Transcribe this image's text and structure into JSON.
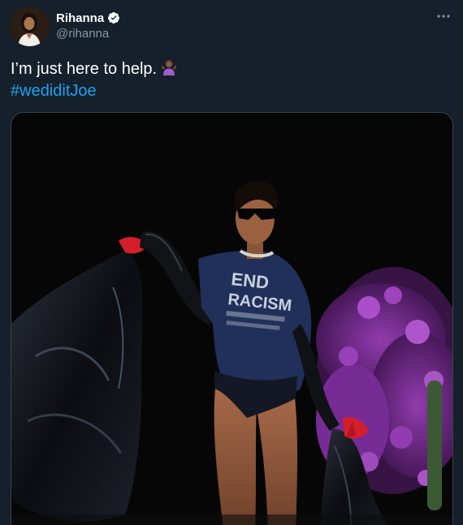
{
  "user": {
    "display_name": "Rihanna",
    "handle": "@rihanna",
    "verified": true,
    "avatar_icon": "profile-photo"
  },
  "tweet": {
    "text": "I’m just here to help.",
    "emoji": "person-shrugging-emoji",
    "hashtag": "#wediditJoe"
  },
  "media": {
    "shirt_text": [
      "END",
      "RACISM"
    ]
  },
  "colors": {
    "background": "#15202b",
    "link": "#1da1f2",
    "secondary_text": "#8899a6",
    "verified_badge": "#ffffff",
    "border": "#38444d"
  },
  "icons": {
    "more": "more-dots-icon",
    "verified": "verified-badge-icon"
  }
}
